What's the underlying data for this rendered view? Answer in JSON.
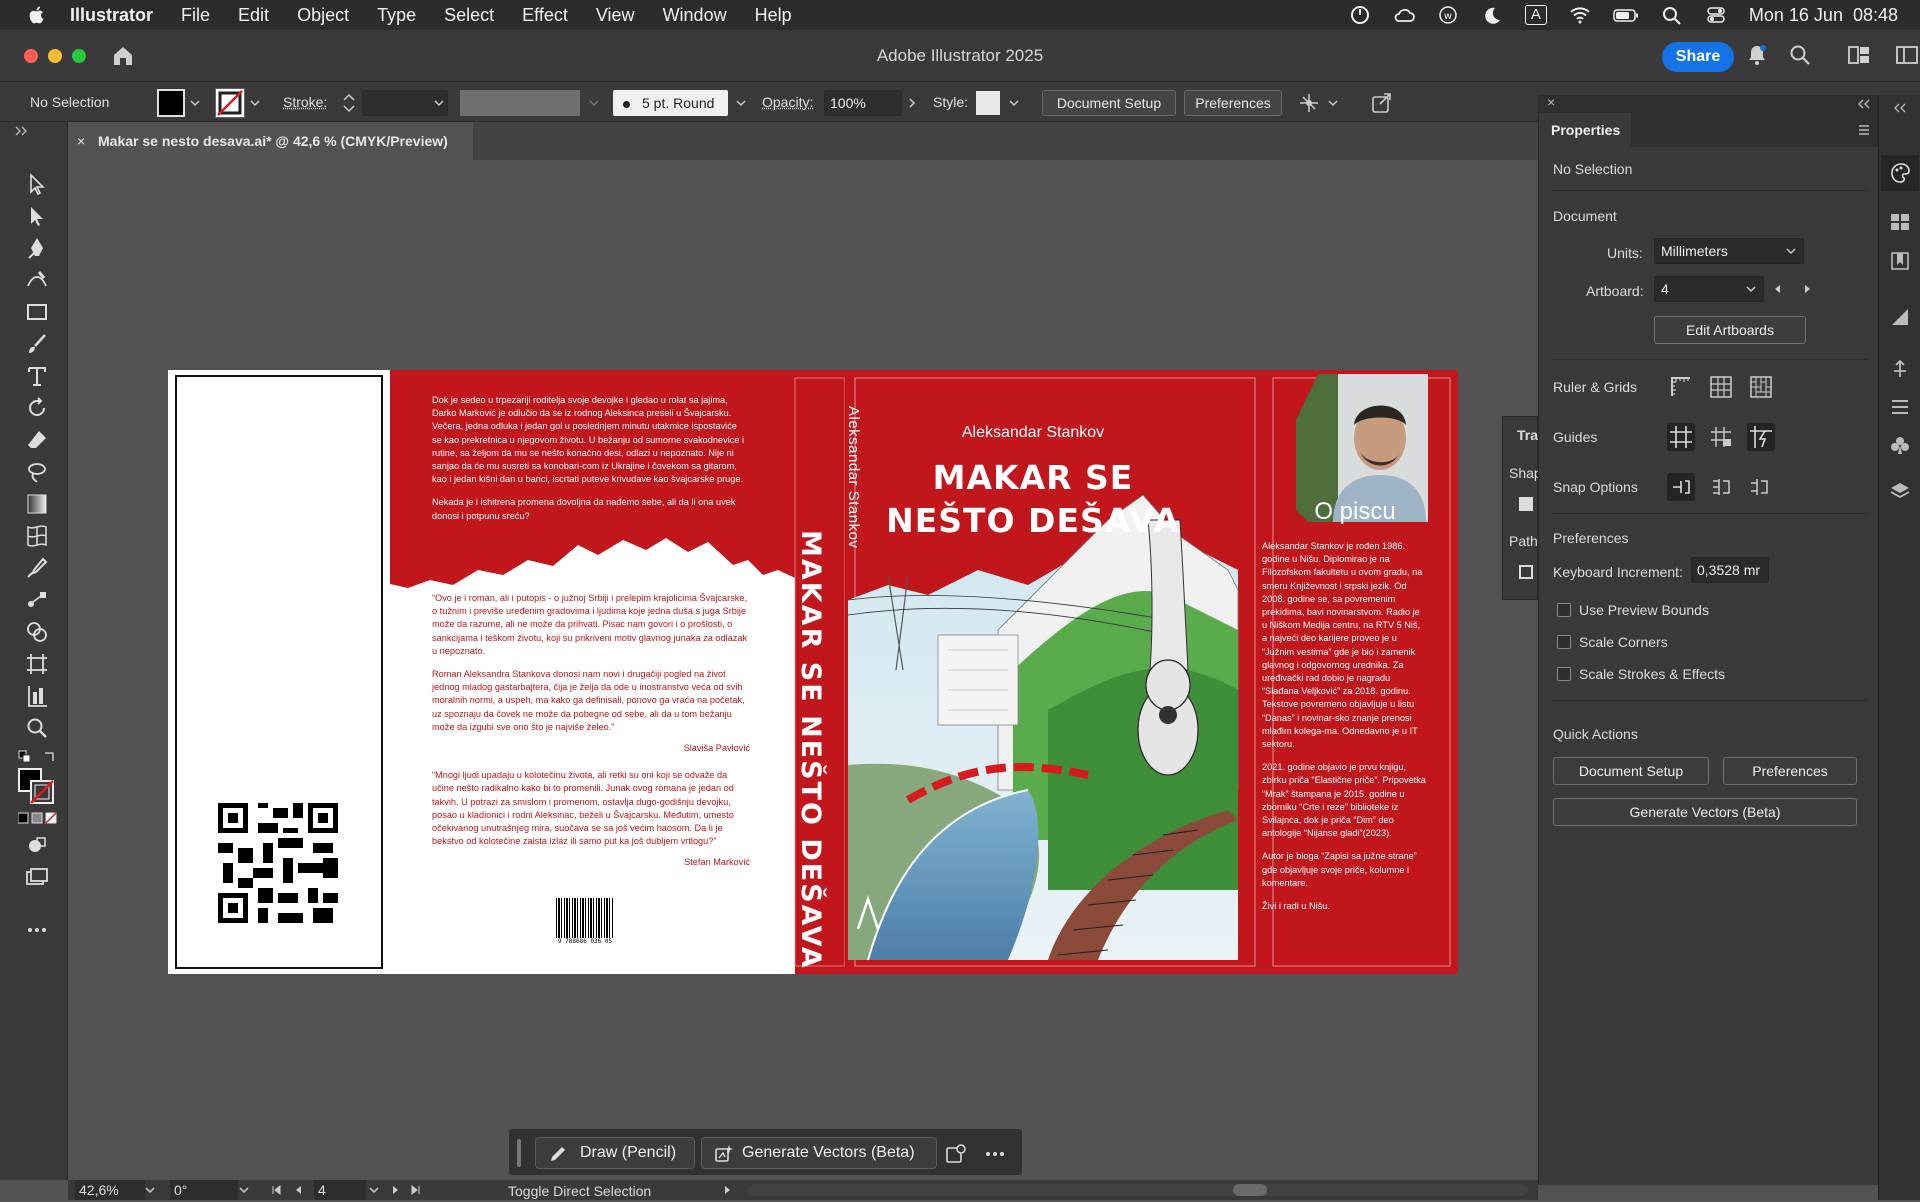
{
  "menubar": {
    "app": "Illustrator",
    "items": [
      "File",
      "Edit",
      "Object",
      "Type",
      "Select",
      "Effect",
      "View",
      "Window",
      "Help"
    ],
    "datetime": "Mon 16 Jun  08:48",
    "input_indicator": "A"
  },
  "window": {
    "title": "Adobe Illustrator 2025",
    "share_label": "Share"
  },
  "controlbar": {
    "selection": "No Selection",
    "stroke_label": "Stroke:",
    "brush": "5 pt. Round",
    "opacity_label": "Opacity:",
    "opacity_value": "100%",
    "style_label": "Style:",
    "document_setup": "Document Setup",
    "preferences": "Preferences"
  },
  "document_tab": {
    "close": "×",
    "label": "Makar se nesto desava.ai* @ 42,6 % (CMYK/Preview)"
  },
  "collapsed_panel": {
    "tab": "Tra",
    "shape": "Shap",
    "path": "Path"
  },
  "properties": {
    "tab": "Properties",
    "selection": "No Selection",
    "document_heading": "Document",
    "units_label": "Units:",
    "units_value": "Millimeters",
    "artboard_label": "Artboard:",
    "artboard_value": "4",
    "edit_artboards": "Edit Artboards",
    "ruler_grids": "Ruler & Grids",
    "guides": "Guides",
    "snap_options": "Snap Options",
    "preferences_heading": "Preferences",
    "keyboard_increment_label": "Keyboard Increment:",
    "keyboard_increment_value": "0,3528 mr",
    "use_preview_bounds": "Use Preview Bounds",
    "scale_corners": "Scale Corners",
    "scale_strokes": "Scale Strokes & Effects",
    "quick_actions": "Quick Actions",
    "qa_document_setup": "Document Setup",
    "qa_preferences": "Preferences",
    "qa_generate_vectors": "Generate Vectors (Beta)"
  },
  "floatbar": {
    "draw_pencil": "Draw (Pencil)",
    "generate_vectors": "Generate Vectors (Beta)"
  },
  "statusbar": {
    "zoom": "42,6%",
    "rotation": "0°",
    "artboard": "4",
    "tool_hint": "Toggle Direct Selection"
  },
  "cover": {
    "back_text_1": "Dok je sedeo u trpezariji roditelja svoje devojke i gledao u rolat sa jajima, Darko Marković je odlučio da se iz rodnog Aleksinca preseli u Švajcarsku. Večera, jedna odluka i jedan gol u poslednjem minutu utakmice ispostaviće se kao prekretnica u njegovom životu. U bežanju od sumorne svakodnevice i rutine, sa željom da mu se nešto konačno desi, odlazi u nepoznato. Nije ni sanjao da će mu susreti sa konobari-com iz Ukrajine i čovekom sa gitarom, kao i jedan kišni dan u banci, iscrtati puteve krivudave kao švajcarske pruge.",
    "back_text_2": "Nekada je i ishitrena promena dovoljna da nađemo sebe, ali da li ona uvek donosi i potpunu sreću?",
    "quote_1": "“Ovo je i roman, ali i putopis - o južnoj Srbiji i prelepim krajolicima Švajcarske, o tužnim i previše uređenim gradovima i ljudima koje jedna duša s juga Srbije može da razume, ali ne može da prihvati. Pisac nam govori i o prošlosti, o sankcijama i teškom životu, koji su prikriveni motiv glavnog junaka za odlazak u nepoznato.",
    "quote_1b": "Roman Aleksandra Stankova donosi nam novi i drugačiji pogled na život jednog mladog gastarbajtera, čija je želja da ode u inostranstvo veća od svih moralnih normi, a uspeh, ma kako ga definisali, ponovo ga vraća na početak, uz spoznaju da čovek ne može da pobegne od sebe, ali da u tom bežanju može da izgubi sve ono što je najviše želeo.”",
    "quote_1_author": "Slaviša Pavlović",
    "quote_2": "“Mnogi ljudi upadaju u kolotečinu života, ali retki su oni koji se odvaže da učine nešto radikalno kako bi to promenili. Junak ovog romana je jedan od takvih. U potrazi za smislom i promenom, ostavlja dugo-godišnju devojku, posao u kladionici i rodni Aleksinac, beželi u Švajcarsku. Međutim, umesto očekivanog unutrašnjeg mira, suočava se sa još većim haosom. Da li je bekstvo od kolotečine zaista izlaz ili samo put ka još dubljem vrtlogu?”",
    "quote_2_author": "Stefan Marković",
    "barcode_digits": "9 788686 036 05",
    "spine_author": "Aleksandar Stankov",
    "spine_title": "MAKAR SE NEŠTO DEŠAVA",
    "front_author": "Aleksandar Stankov",
    "front_title_1": "MAKAR SE",
    "front_title_2": "NEŠTO DEŠAVA",
    "flap_heading": "O piscu",
    "bio_1": "Aleksandar Stankov je rođen 1986. godine u Nišu. Diplomirao je na Filozofskom fakultetu u ovom gradu, na smeru Književnost i srpski jezik. Od 2008. godine se, sa povremenim prekidima, bavi novinarstvom. Radio je u Niškom Medija centru, na RTV 5 Niš, a najveći deo karijere proveo je u “Južnim vestima” gde je bio i zamenik glavnog i odgovornog urednika. Za uređivački rad dobio je nagradu “Slađana Veljković” za 2018. godinu. Tekstove povremeno objavljuje u listu “Danas” i novinar-sko znanje prenosi mlađim kolega-ma. Odnedavno je u IT sektoru.",
    "bio_2": "2021. godine objavio je prvu knjigu, zbirku priča “Elastične priče”. Pripovetka “Mrak” štampana je 2015. godine u zborniku “Crte i reze” biblioteke iz Svilajnca, dok je priča “Dim” deo antologije “Nijanse gladi”(2023).",
    "bio_3": "Autor je bloga “Zapisi sa južne strane” gde objavljuje svoje priče, kolumne i komentare.",
    "bio_4": "Živi i radi u Nišu.",
    "accent": "#c0161c"
  }
}
